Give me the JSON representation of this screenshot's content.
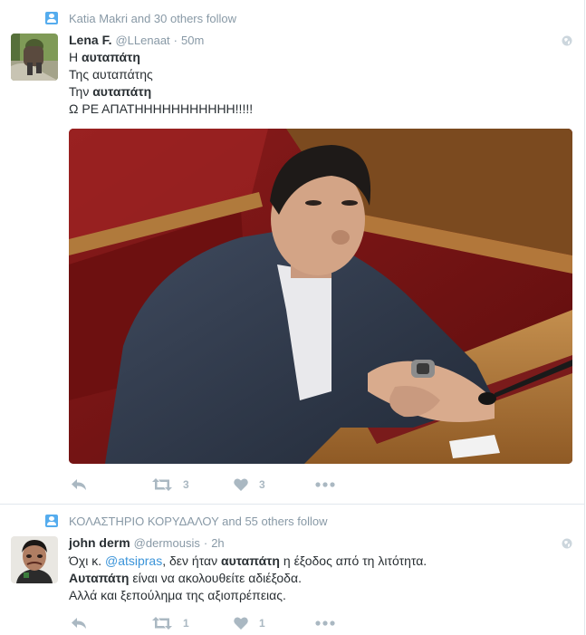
{
  "tweets": [
    {
      "context": "Katia Makri and 30 others follow",
      "name": "Lena F.",
      "handle": "@LLenaat",
      "separator": "·",
      "time": "50m",
      "lines": [
        {
          "pre": "Η ",
          "bold": "αυταπάτη",
          "post": ""
        },
        {
          "pre": "Της αυταπάτης",
          "bold": "",
          "post": ""
        },
        {
          "pre": "Την ",
          "bold": "αυταπάτη",
          "post": ""
        },
        {
          "pre": "Ω ΡΕ ΑΠΑΤΗΗΗΗΗΗΗΗΗΗΗ!!!!!",
          "bold": "",
          "post": ""
        }
      ],
      "retweets": "3",
      "likes": "3"
    },
    {
      "context": "ΚΟΛΑΣΤΗΡΙΟ ΚΟΡΥΔΑΛΟΥ and 55 others follow",
      "name": "john derm",
      "handle": "@dermousis",
      "separator": "·",
      "time": "2h",
      "line1": {
        "pre": "Όχι κ. ",
        "mention": "@atsipras",
        "mid": ", δεν ήταν ",
        "bold": "αυταπάτη",
        "post": " η έξοδος από τη λιτότητα."
      },
      "line2": {
        "bold": "Αυταπάτη",
        "post": " είναι να ακολουθείτε αδιέξοδα."
      },
      "line3": "Αλλά και ξεπούλημα της αξιοπρέπειας.",
      "retweets": "1",
      "likes": "1"
    }
  ],
  "icons": {
    "context": "person-follow-icon",
    "globe": "globe-icon",
    "reply": "reply-icon",
    "retweet": "retweet-icon",
    "like": "heart-icon",
    "more": "more-dots-icon"
  },
  "colors": {
    "accent": "#55acee",
    "link": "#3b94d9",
    "muted": "#8899a6",
    "action": "#aab8c2",
    "text": "#292f33"
  }
}
